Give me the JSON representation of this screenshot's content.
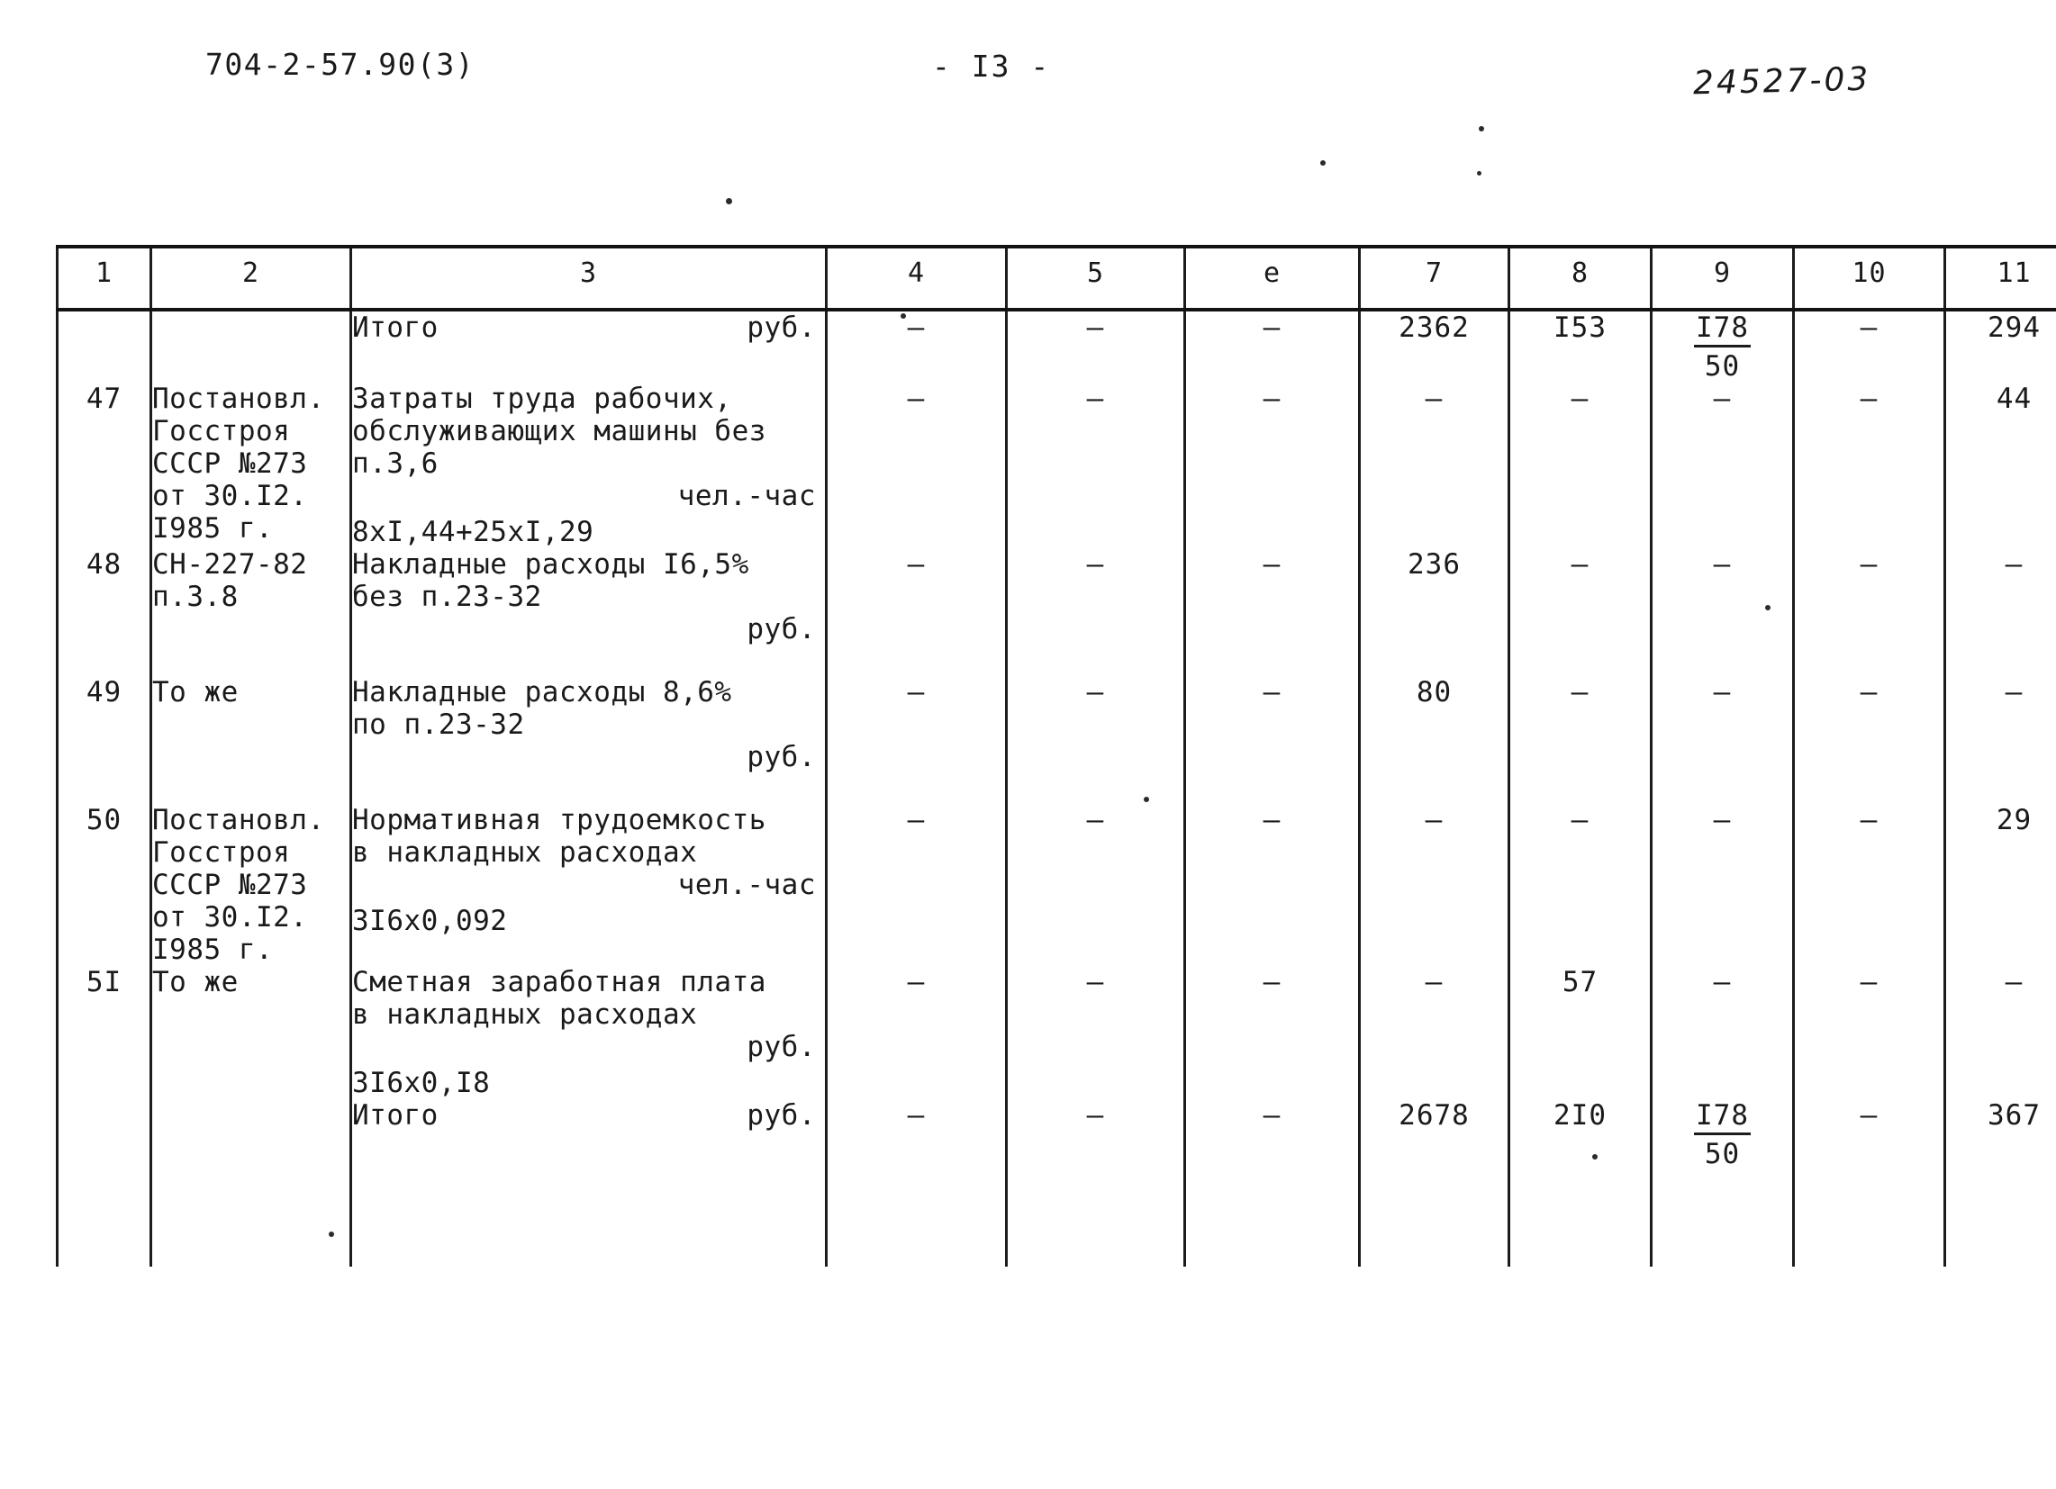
{
  "header": {
    "doc_code": "704-2-57.90(3)",
    "page_number": "- I3 -",
    "archive_code": "24527-03"
  },
  "table": {
    "column_headers": [
      "1",
      "2",
      "3",
      "4",
      "5",
      "e",
      "7",
      "8",
      "9",
      "10",
      "11"
    ],
    "rows": [
      {
        "num": "",
        "source": "",
        "desc_lines": [
          "Итого"
        ],
        "unit": "руб.",
        "formula": "",
        "c4": "–",
        "c5": "–",
        "c6": "–",
        "c7": "2362",
        "c8": "I53",
        "c9_numerator": "I78",
        "c9_denominator": "50",
        "c10": "–",
        "c11": "294"
      },
      {
        "num": "47",
        "source": "Постановл.\nГосстроя\nСССР №273\nот 30.I2.\nI985 г.",
        "desc_lines": [
          "Затраты труда рабочих,",
          "обслуживающих машины без",
          "п.3,6"
        ],
        "unit": "чел.-час",
        "formula": "8xI,44+25xI,29",
        "c4": "–",
        "c5": "–",
        "c6": "–",
        "c7": "–",
        "c8": "–",
        "c9": "–",
        "c10": "–",
        "c11": "44"
      },
      {
        "num": "48",
        "source": "СН-227-82\nп.3.8",
        "desc_lines": [
          "Накладные расходы I6,5%",
          "без п.23-32"
        ],
        "unit": "руб.",
        "formula": "",
        "c4": "–",
        "c5": "–",
        "c6": "–",
        "c7": "236",
        "c8": "–",
        "c9": "–",
        "c10": "–",
        "c11": "–"
      },
      {
        "num": "49",
        "source": "То же",
        "desc_lines": [
          "Накладные расходы 8,6%",
          "по п.23-32"
        ],
        "unit": "руб.",
        "formula": "",
        "c4": "–",
        "c5": "–",
        "c6": "–",
        "c7": "80",
        "c8": "–",
        "c9": "–",
        "c10": "–",
        "c11": "–"
      },
      {
        "num": "50",
        "source": "Постановл.\nГосстроя\nСССР №273\nот 30.I2.\nI985 г.",
        "desc_lines": [
          "Нормативная трудоемкость",
          "в накладных расходах"
        ],
        "unit": "чел.-час",
        "formula": "3I6x0,092",
        "c4": "–",
        "c5": "–",
        "c6": "–",
        "c7": "–",
        "c8": "–",
        "c9": "–",
        "c10": "–",
        "c11": "29"
      },
      {
        "num": "5I",
        "source": "То же",
        "desc_lines": [
          "Сметная заработная плата",
          "в накладных расходах"
        ],
        "unit": "руб.",
        "formula": "3I6x0,I8",
        "c4": "–",
        "c5": "–",
        "c6": "–",
        "c7": "–",
        "c8": "57",
        "c9": "–",
        "c10": "–",
        "c11": "–"
      },
      {
        "num": "",
        "source": "",
        "desc_lines": [
          "Итого"
        ],
        "unit": "руб.",
        "formula": "",
        "c4": "–",
        "c5": "–",
        "c6": "–",
        "c7": "2678",
        "c8": "2I0",
        "c9_numerator": "I78",
        "c9_denominator": "50",
        "c10": "–",
        "c11": "367"
      }
    ]
  }
}
